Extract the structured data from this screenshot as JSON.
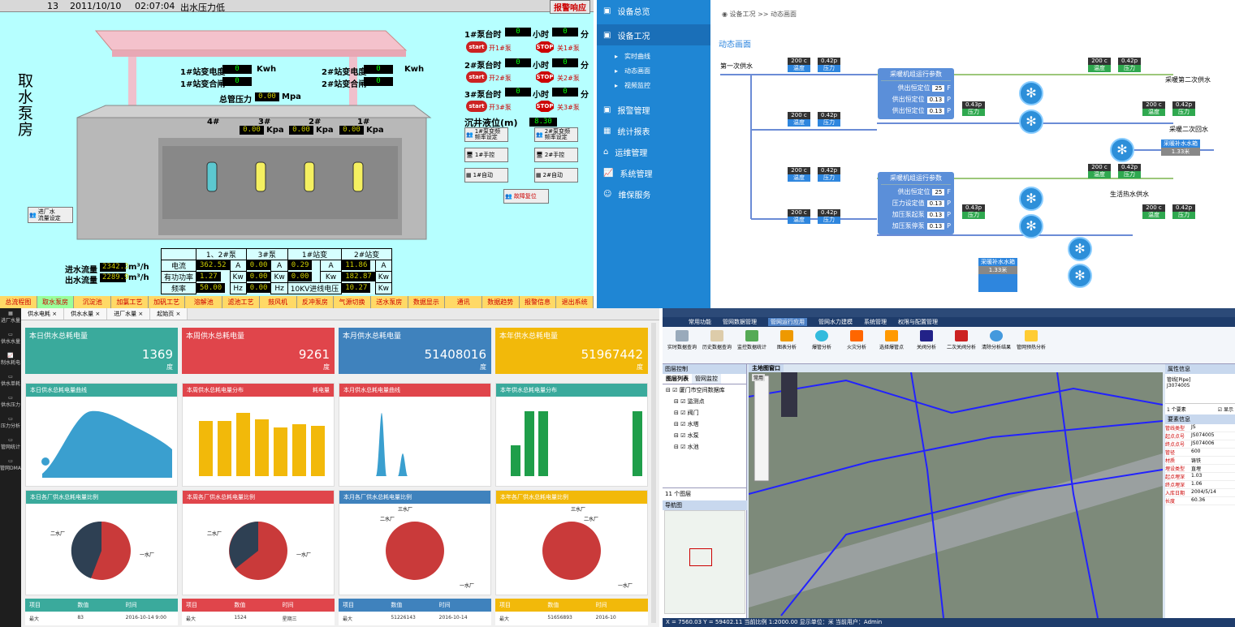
{
  "q1": {
    "topbar": {
      "a": "13",
      "date": "2011/10/10",
      "time": "02:07:04",
      "msg": "出水压力低",
      "alarm": "报警响应"
    },
    "house_title": [
      "取",
      "水",
      "泵",
      "房"
    ],
    "st1_kwh_label": "1#站变电度",
    "st1_kwh": "0",
    "st1_kwh_unit": "Kwh",
    "st1_sw_label": "1#站变合闸",
    "st1_sw": "0",
    "st2_kwh_label": "2#站变电度",
    "st2_kwh": "0",
    "st2_kwh_unit": "Kwh",
    "st2_sw_label": "2#站变合闸",
    "st2_sw": "0",
    "pressure_label": "总管压力",
    "pressure": "0.00",
    "pressure_unit": "Mpa",
    "pumps": [
      {
        "label": "4#",
        "val": "",
        "unit": ""
      },
      {
        "label": "3#",
        "val": "0.00",
        "unit": "Kpa"
      },
      {
        "label": "2#",
        "val": "0.00",
        "unit": "Kpa"
      },
      {
        "label": "1#",
        "val": "0.00",
        "unit": "Kpa"
      }
    ],
    "factory_btn": "进厂水\n流量设定",
    "pump_hours": [
      {
        "label": "1#泵台时",
        "h": "0",
        "h_unit": "小时",
        "m": "0",
        "m_unit": "分",
        "start": "start",
        "start_txt": "开1#泵",
        "stop": "STOP",
        "stop_txt": "关1#泵"
      },
      {
        "label": "2#泵台时",
        "h": "0",
        "h_unit": "小时",
        "m": "0",
        "m_unit": "分",
        "start": "start",
        "start_txt": "开2#泵",
        "stop": "STOP",
        "stop_txt": "关2#泵"
      },
      {
        "label": "3#泵台时",
        "h": "0",
        "h_unit": "小时",
        "m": "0",
        "m_unit": "分",
        "start": "start",
        "start_txt": "开3#泵",
        "stop": "STOP",
        "stop_txt": "关3#泵"
      }
    ],
    "well_label": "沉井液位(m)",
    "well": "8.30",
    "set1": "1#泵变频\n频率设定",
    "set2": "2#泵变频\n频率设定",
    "manual1": "1#手控",
    "manual2": "2#手控",
    "auto1": "1#自动",
    "auto2": "2#自动",
    "fault_reset": "故障复位",
    "inflow_label": "进水流量",
    "inflow": "2342.3",
    "outflow_label": "出水流量",
    "outflow": "2289.9",
    "flow_unit": "m³/h",
    "table": {
      "head": [
        "",
        "1、2#泵",
        "3#泵",
        "1#站变",
        "2#站变"
      ],
      "rows": [
        {
          "name": "电流",
          "v": [
            "362.52",
            "A",
            "0.00",
            "A",
            "0.29",
            "A",
            "11.86",
            "A"
          ]
        },
        {
          "name": "有功功率",
          "v": [
            "1.27",
            "Kw",
            "0.00",
            "Kw",
            "0.00",
            "Kw",
            "182.87",
            "Kw"
          ]
        },
        {
          "name": "频率",
          "v": [
            "50.00",
            "Hz",
            "0.00",
            "Hz",
            "10KV进线电压",
            "",
            "10.27",
            "Kw"
          ]
        }
      ]
    },
    "nav": [
      "总流程图",
      "取水泵房",
      "沉淀池",
      "加氯工艺",
      "加矾工艺",
      "溶解池",
      "滤池工艺",
      "鼓风机",
      "反冲泵房",
      "气源切换",
      "送水泵房",
      "数据显示",
      "通讯",
      "数据趋势",
      "报警信息",
      "退出系统"
    ]
  },
  "q2": {
    "menu": [
      "设备总览",
      "设备工况",
      "报警管理",
      "统计报表",
      "运维管理",
      "系统管理",
      "维保服务"
    ],
    "sub": [
      "实时曲线",
      "动态画面",
      "视频监控"
    ],
    "breadcrumb": "设备工况 >> 动态画面",
    "page_title": "动态画面",
    "first_supply": "第一次供水",
    "second_supply": "采暖第二次供水",
    "second_return": "采暖二次回水",
    "hot_water": "生活热水供水",
    "box1": {
      "title": "采暖机组运行参数",
      "rows": [
        {
          "k": "供出恒定位",
          "v": "25",
          "u": "F"
        },
        {
          "k": "供出恒定位",
          "v": "0.13",
          "u": "P"
        },
        {
          "k": "供出恒定位",
          "v": "0.13",
          "u": "P"
        }
      ]
    },
    "box2": {
      "title": "采暖机组运行参数",
      "rows": [
        {
          "k": "供出恒定位",
          "v": "25",
          "u": "F"
        },
        {
          "k": "压力设定值",
          "v": "0.13",
          "u": "P"
        },
        {
          "k": "加压泵起泵",
          "v": "0.13",
          "u": "P"
        },
        {
          "k": "加压泵停泵",
          "v": "0.13",
          "u": "P"
        }
      ]
    },
    "tank1": {
      "title": "采暖补水水箱",
      "val": "1.33米"
    },
    "tank2": {
      "title": "采暖补水水箱",
      "val": "1.33米"
    },
    "t_temp": "200 c",
    "t_temp_l": "温度",
    "t_pres": "0.42p",
    "t_pres_l": "压力",
    "t_pres2": "0.43p"
  },
  "q3": {
    "side": [
      "进厂水量",
      "供水水量",
      "制水耗电",
      "供水单耗",
      "供水压力",
      "压力分析",
      "管网统计",
      "管网DMA"
    ],
    "tabs": [
      "供水电耗 ×",
      "供水水量 ×",
      "进厂水量 ×",
      "起始页 ×"
    ],
    "kpis": [
      {
        "title": "本日供水总耗电量",
        "val": "1369",
        "unit": "度",
        "color": "#3aaa9c"
      },
      {
        "title": "本周供水总耗电量",
        "val": "9261",
        "unit": "度",
        "color": "#e0454b"
      },
      {
        "title": "本月供水总耗电量",
        "val": "51408016",
        "unit": "度",
        "color": "#3f82bd"
      },
      {
        "title": "本年供水总耗电量",
        "val": "51967442",
        "unit": "度",
        "color": "#f2b90a"
      }
    ],
    "curves": [
      {
        "title": "本日供水总耗电量曲线",
        "color": "#3aaa9c"
      },
      {
        "title": "本周供水总耗电量分布",
        "color": "#e0454b",
        "legend": "耗电量"
      },
      {
        "title": "本月供水总耗电量曲线",
        "color": "#e0454b"
      },
      {
        "title": "本年供水总耗电量分布",
        "color": "#3aaa9c",
        "legend": ""
      }
    ],
    "pies": [
      {
        "title": "本日各厂供水总耗电量比例",
        "color": "#3aaa9c",
        "a": "二水厂",
        "b": "一水厂"
      },
      {
        "title": "本周各厂供水总耗电量比例",
        "color": "#e0454b",
        "a": "二水厂",
        "b": "一水厂"
      },
      {
        "title": "本月各厂供水总耗电量比例",
        "color": "#3f82bd",
        "a": "三水厂",
        "a2": "二水厂",
        "b": "一水厂"
      },
      {
        "title": "本年各厂供水总耗电量比例",
        "color": "#f2b90a",
        "a": "三水厂",
        "a2": "二水厂",
        "b": "一水厂"
      }
    ],
    "tables": [
      {
        "h": [
          "项目",
          "数值",
          "时间"
        ],
        "b": [
          "最大",
          "83",
          "2016-10-14 9:00"
        ],
        "color": "#3aaa9c"
      },
      {
        "h": [
          "项目",
          "数值",
          "时间"
        ],
        "b": [
          "最大",
          "1524",
          "星期三"
        ],
        "color": "#e0454b"
      },
      {
        "h": [
          "项目",
          "数值",
          "时间"
        ],
        "b": [
          "最大",
          "51226143",
          "2016-10-14"
        ],
        "color": "#3f82bd"
      },
      {
        "h": [
          "项目",
          "数值",
          "时间"
        ],
        "b": [
          "最大",
          "51656893",
          "2016-10"
        ],
        "color": "#f2b90a"
      }
    ]
  },
  "q4": {
    "title": "",
    "menu": [
      "常用功能",
      "管网数据管理",
      "管网运行应用",
      "管网水力建模",
      "系统管理",
      "权限与配置管理"
    ],
    "ribbon": [
      "实时数据查询",
      "历史数据查询",
      "监控数据统计",
      "图表分析",
      "爆管分析",
      "火灾分析",
      "选择爆管点",
      "关阀分析",
      "二次关阀分析",
      "清除分析结果",
      "管网预热分析"
    ],
    "layer_title": "图层控制",
    "layer_tabs": [
      "图层列表",
      "管网监控"
    ],
    "layers": [
      "厦门市空间数据库",
      "监测点",
      "阀门",
      "水塔",
      "水泵",
      "水池"
    ],
    "layer_count": "11 个图层",
    "nav_title": "导航图",
    "map_tab": "主地图窗口",
    "tool_tab": "常用",
    "prop_title": "属性信息",
    "prop_sel": "管线[Pipe]",
    "prop_sel2": "J3074005",
    "prop_count": "1 个要素",
    "prop_show": "显示",
    "props_head": "要素信息",
    "props": [
      [
        "管线类型",
        "JS"
      ],
      [
        "起点点号",
        "JS074005"
      ],
      [
        "终点点号",
        "JS074006"
      ],
      [
        "管径",
        "600"
      ],
      [
        "材质",
        "铸铁"
      ],
      [
        "埋设类型",
        "直埋"
      ],
      [
        "起点埋深",
        "1.03"
      ],
      [
        "终点埋深",
        "1.06"
      ],
      [
        "入库日期",
        "2004/5/14"
      ],
      [
        "长度",
        "60.36"
      ]
    ],
    "status": "X = 7560.03  Y = 59402.11   当前比例 1:2000.00   显示单位：米   当前用户：Admin"
  }
}
